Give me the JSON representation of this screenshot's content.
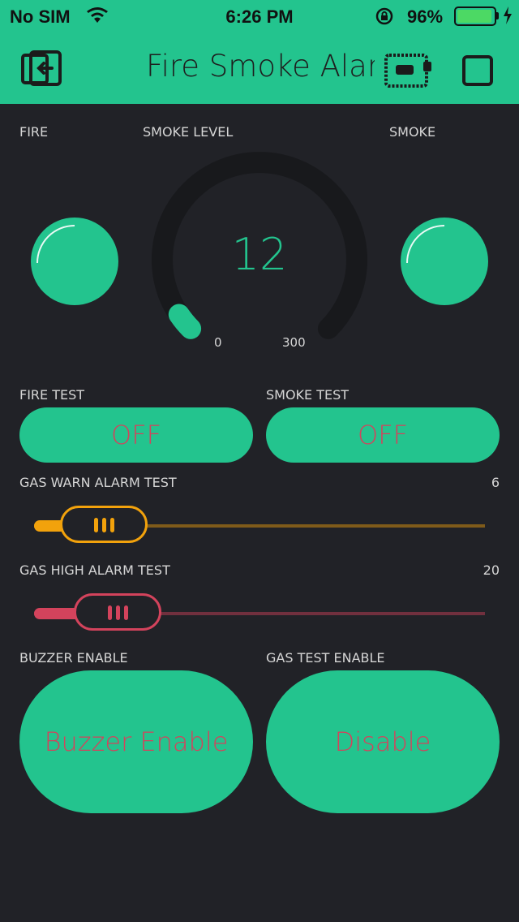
{
  "status_bar": {
    "carrier": "No SIM",
    "time": "6:26 PM",
    "battery_percent": "96%",
    "battery_level": 0.96
  },
  "nav": {
    "title": "Fire Smoke Alarm",
    "back_icon": "exit-icon",
    "device_icon": "device-board-icon",
    "stop_icon": "stop-icon"
  },
  "widgets": {
    "fire_led": {
      "label": "FIRE",
      "color": "#23c48e"
    },
    "smoke_gauge": {
      "label": "SMOKE LEVEL",
      "value": "12",
      "min": "0",
      "max": "300",
      "level": 0.04
    },
    "smoke_led": {
      "label": "SMOKE",
      "color": "#23c48e"
    },
    "fire_test": {
      "label": "FIRE TEST",
      "button": "OFF"
    },
    "smoke_test": {
      "label": "SMOKE TEST",
      "button": "OFF"
    },
    "gas_warn": {
      "label": "GAS WARN ALARM TEST",
      "value": "6",
      "color": "#f2a20c",
      "level": 0.06
    },
    "gas_high": {
      "label": "GAS HIGH ALARM TEST",
      "value": "20",
      "color": "#d3435c",
      "level": 0.2
    },
    "buzzer_enable": {
      "label": "BUZZER ENABLE",
      "button": "Buzzer Enable"
    },
    "gas_test_enable": {
      "label": "GAS TEST ENABLE",
      "button": "Disable"
    }
  },
  "colors": {
    "accent": "#23c48e",
    "background": "#212227",
    "button_text": "#d3435c"
  }
}
